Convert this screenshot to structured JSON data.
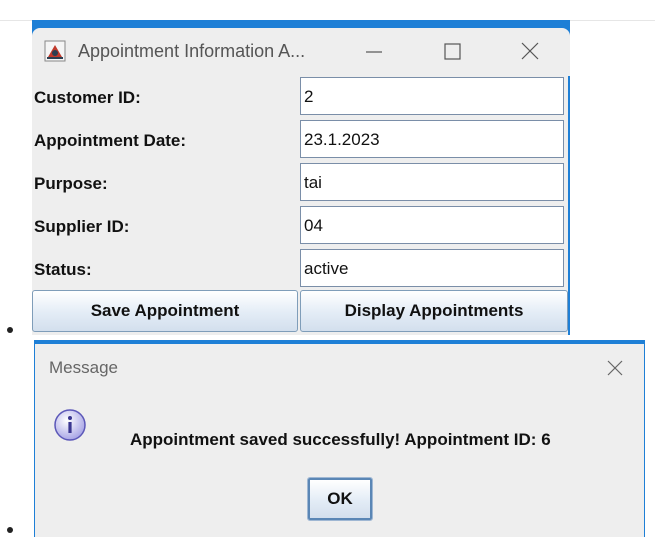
{
  "main_window": {
    "title": "Appointment Information A...",
    "fields": [
      {
        "label": "Customer ID:",
        "value": "2"
      },
      {
        "label": "Appointment Date:",
        "value": "23.1.2023"
      },
      {
        "label": "Purpose:",
        "value": "tai"
      },
      {
        "label": "Supplier ID:",
        "value": "04"
      },
      {
        "label": "Status:",
        "value": "active"
      }
    ],
    "buttons": {
      "save": "Save Appointment",
      "display": "Display Appointments"
    }
  },
  "message_dialog": {
    "title": "Message",
    "text": "Appointment saved successfully! Appointment ID: 6",
    "ok": "OK"
  },
  "colors": {
    "accent": "#1e7fd6",
    "window_bg": "#eeeeee"
  },
  "icons": [
    "java-app-icon",
    "minimize-icon",
    "maximize-icon",
    "close-icon",
    "info-icon"
  ]
}
